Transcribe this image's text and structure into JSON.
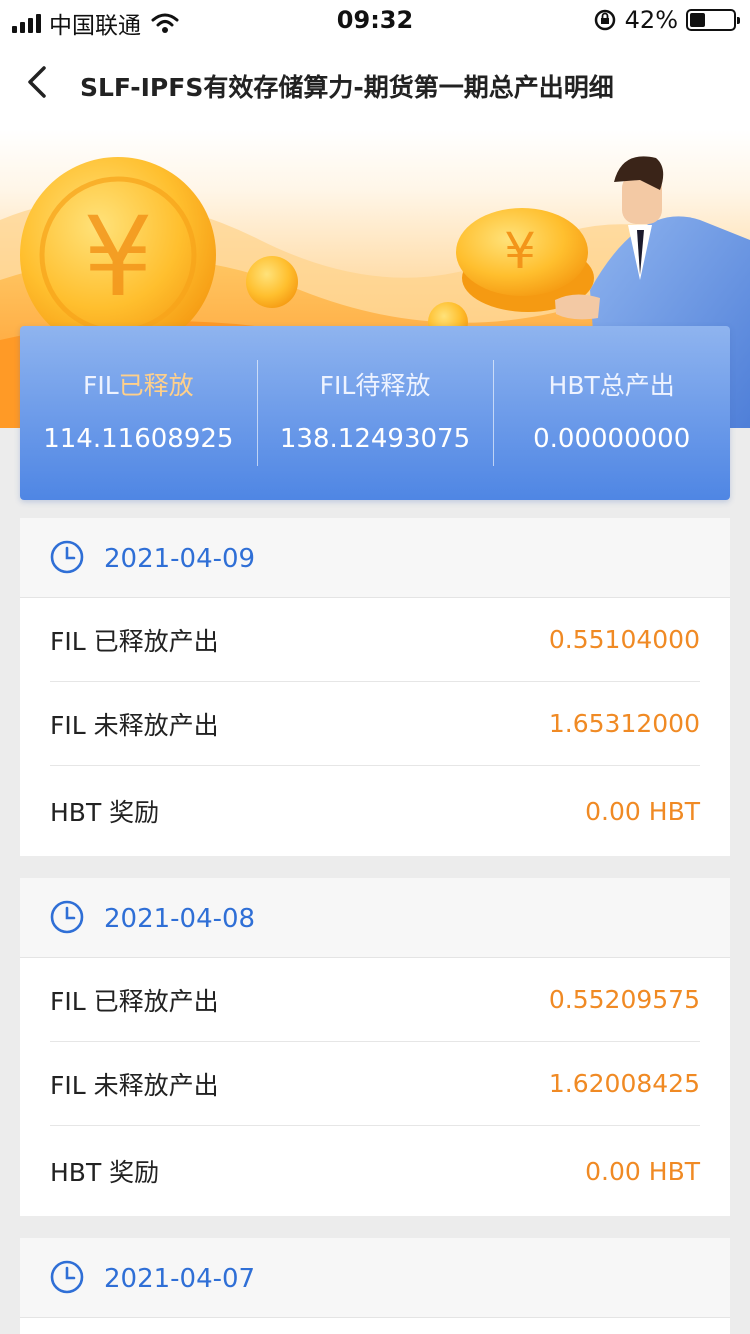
{
  "status_bar": {
    "carrier": "中国联通",
    "time": "09:32",
    "battery": "42%",
    "battery_level": 0.42
  },
  "nav": {
    "title": "SLF-IPFS有效存储算力-期货第一期总产出明细"
  },
  "summary": [
    {
      "label_prefix": "FIL",
      "label_highlight": "已释放",
      "value": "114.11608925"
    },
    {
      "label_prefix": "FIL",
      "label_highlight": "待释放",
      "value": "138.12493075"
    },
    {
      "label_prefix": "HBT",
      "label_highlight": "总产出",
      "value": "0.00000000"
    }
  ],
  "days": [
    {
      "date": "2021-04-09",
      "rows": [
        {
          "label": "FIL 已释放产出",
          "value": "0.55104000"
        },
        {
          "label": "FIL 未释放产出",
          "value": "1.65312000"
        },
        {
          "label": "HBT 奖励",
          "value": "0.00 HBT"
        }
      ]
    },
    {
      "date": "2021-04-08",
      "rows": [
        {
          "label": "FIL 已释放产出",
          "value": "0.55209575"
        },
        {
          "label": "FIL 未释放产出",
          "value": "1.62008425"
        },
        {
          "label": "HBT 奖励",
          "value": "0.00 HBT"
        }
      ]
    },
    {
      "date": "2021-04-07"
    }
  ],
  "colors": {
    "accent_blue": "#2f6fd6",
    "value_orange": "#f08a24",
    "card_blue": "#6b9ae9"
  }
}
